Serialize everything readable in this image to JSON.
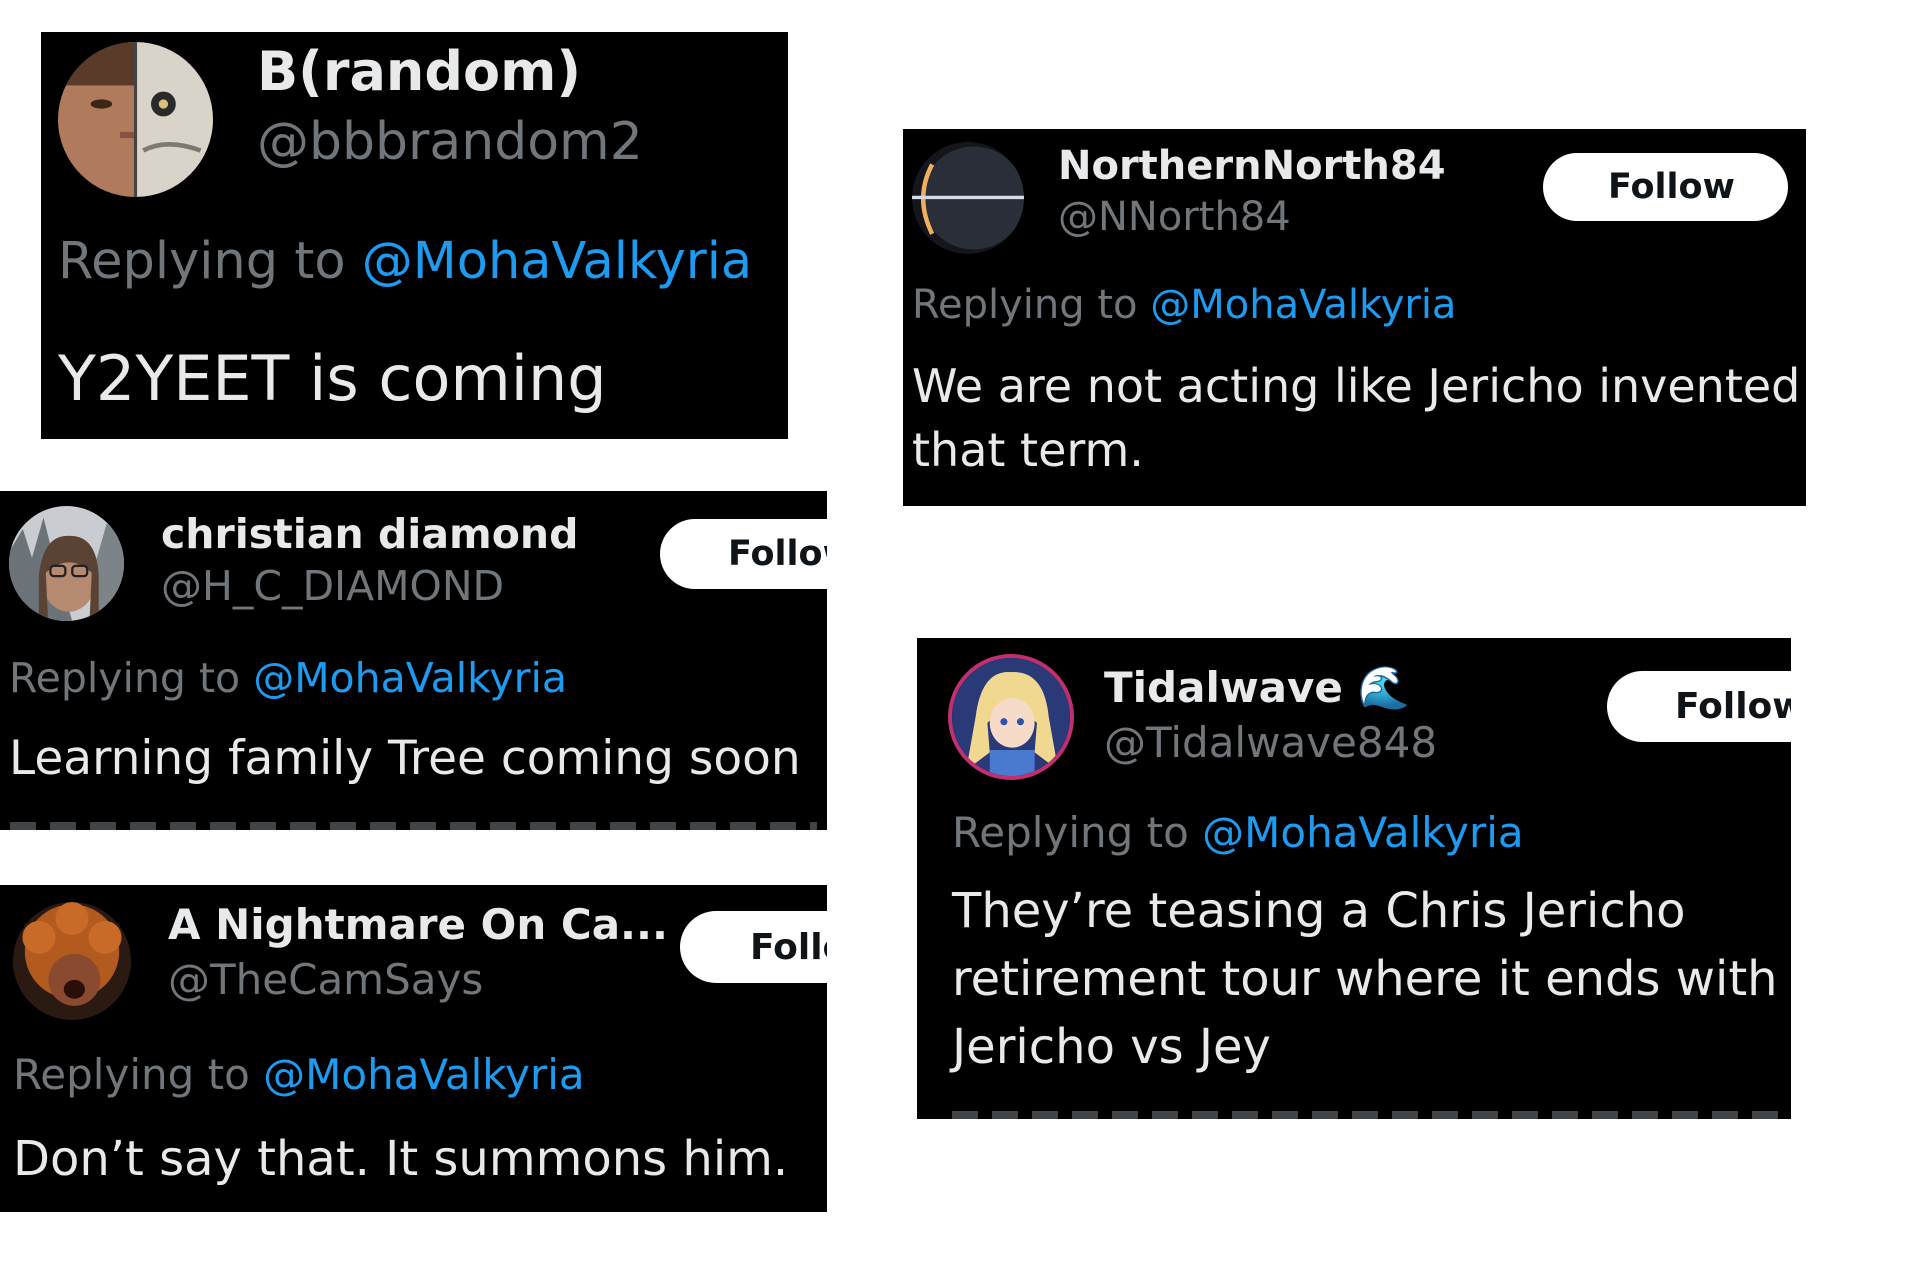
{
  "tweets": [
    {
      "name": "B(random)",
      "handle": "@bbbrandom2",
      "reply_prefix": "Replying to ",
      "reply_to": "@MohaValkyria",
      "text": "Y2YEET is coming",
      "avatar_icon": "half-face-half-cat-avatar"
    },
    {
      "name": "NorthernNorth84",
      "handle": "@NNorth84",
      "follow_label": "Follow",
      "reply_prefix": "Replying to ",
      "reply_to": "@MohaValkyria",
      "text_lines": [
        "We are not acting like Jericho invented",
        "that term."
      ],
      "avatar_icon": "planet-eclipse-avatar"
    },
    {
      "name": "christian diamond",
      "handle": "@H_C_DIAMOND",
      "follow_label": "Follow",
      "reply_prefix": "Replying to ",
      "reply_to": "@MohaValkyria",
      "text": "Learning family Tree coming soon",
      "avatar_icon": "person-glasses-avatar"
    },
    {
      "name": "Tidalwave",
      "name_emoji": "🌊",
      "handle": "@Tidalwave848",
      "follow_label": "Follow",
      "reply_prefix": "Replying to ",
      "reply_to": "@MohaValkyria",
      "text_lines": [
        "They’re teasing a Chris Jericho",
        "retirement tour where it ends with",
        "Jericho vs Jey"
      ],
      "avatar_icon": "anime-character-avatar"
    },
    {
      "name": "A Nightmare On Ca...",
      "handle": "@TheCamSays",
      "follow_label": "Follow",
      "reply_prefix": "Replying to ",
      "reply_to": "@MohaValkyria",
      "text": "Don’t say that. It summons him.",
      "avatar_icon": "curly-hair-person-avatar"
    }
  ],
  "colors": {
    "card_bg": "#000000",
    "name": "#e7e9ea",
    "muted": "#71767b",
    "mention": "#1d9bf0",
    "follow_bg": "#ffffff",
    "page_bg": "#ffffff"
  }
}
